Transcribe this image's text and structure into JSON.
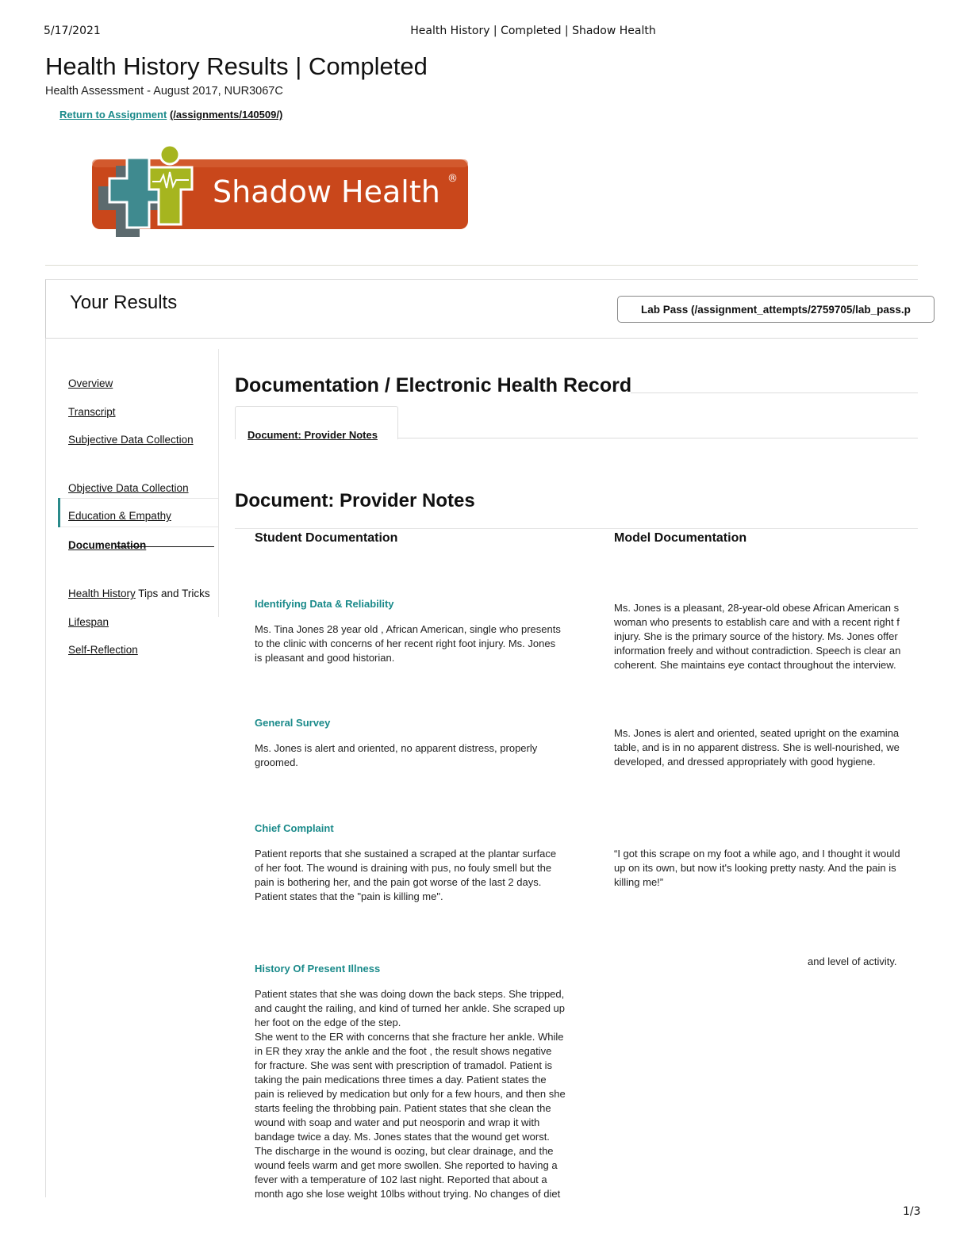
{
  "print_header": {
    "date": "5/17/2021",
    "title": "Health History | Completed | Shadow Health",
    "page": "1/3"
  },
  "page": {
    "title": "Health History Results | Completed",
    "subtitle": "Health Assessment - August 2017, NUR3067C",
    "return_link_text": "Return to Assignment",
    "return_link_url": "(/assignments/140509/)"
  },
  "logo": {
    "text": "Shadow Health",
    "mark": "®",
    "colors": {
      "orange": "#c9471b",
      "teal": "#3f8a8f",
      "green": "#a6b51f",
      "gray": "#5c6a6e"
    }
  },
  "results": {
    "title": "Your Results",
    "lab_pass": "Lab Pass (/assignment_attempts/2759705/lab_pass.p"
  },
  "sidebar": {
    "items": [
      {
        "label": "Overview"
      },
      {
        "label": "Transcript"
      },
      {
        "label": "Subjective Data Collection"
      },
      {
        "label": "Objective Data Collection"
      },
      {
        "label": "Education & Empathy"
      },
      {
        "label": "Documentation"
      },
      {
        "label": "Health History",
        "suffix": " Tips and Tricks"
      },
      {
        "label": "Lifespan"
      },
      {
        "label": "Self-Reflection"
      }
    ]
  },
  "main": {
    "section_title": "Documentation / Electronic Health Record",
    "tab_label": "Document: Provider Notes",
    "doc_title": "Document: Provider Notes",
    "student_header": "Student Documentation",
    "model_header": "Model Documentation",
    "sections": [
      {
        "label": "Identifying Data & Reliability",
        "student": "Ms. Tina Jones 28 year old , African American, single who presents\nto the clinic with concerns of her recent right foot injury. Ms. Jones\nis pleasant and good historian.",
        "model": "Ms. Jones is a pleasant, 28-year-old obese African American s\nwoman who presents to establish care and with a recent right f\ninjury. She is the primary source of the history. Ms. Jones offer\ninformation freely and without contradiction. Speech is clear an\ncoherent. She maintains eye contact throughout the interview."
      },
      {
        "label": "General Survey",
        "student": "Ms. Jones is alert and oriented, no apparent distress, properly\ngroomed.",
        "model": "Ms. Jones is alert and oriented, seated upright on the examina\ntable, and is in no apparent distress. She is well-nourished, we\ndeveloped, and dressed appropriately with good hygiene."
      },
      {
        "label": "Chief Complaint",
        "student": "Patient reports that she sustained a scraped at the plantar surface\nof her foot. The wound is draining with pus, no fouly smell but the\npain is bothering her, and the pain got worse of the last 2 days.\nPatient states that the \"pain is killing me\".",
        "model": "“I got this scrape on my foot a while ago, and I thought it would\nup on its own, but now it's looking pretty nasty. And the pain is\nkilling me!”"
      },
      {
        "label": "History Of Present Illness",
        "student": "Patient states that she was doing down the back steps. She tripped,\nand caught the railing, and kind of turned her ankle. She scraped up\nher foot on the edge of the step.\nShe went to the ER with concerns that she fracture her ankle. While\nin ER they xray the ankle and the foot , the result shows negative\nfor fracture. She was sent with prescription of tramadol. Patient is\ntaking the pain medications three times a day. Patient states the\npain is relieved by medication but only for a few hours, and then she\nstarts feeling the throbbing pain. Patient states that she clean the\nwound with soap and water and put neosporin and wrap it with\nbandage twice a day. Ms. Jones states that the wound get worst.\nThe discharge in the wound is oozing, but clear drainage, and the\nwound feels warm and get more swollen. She reported to having a\nfever with a temperature of 102 last night. Reported that about a\nmonth ago she lose weight 10lbs without trying. No changes of diet",
        "model": "and level of activity."
      }
    ]
  }
}
